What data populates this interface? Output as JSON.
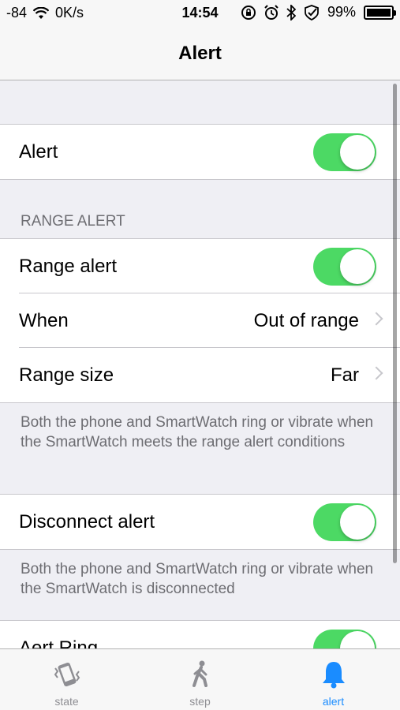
{
  "status_bar": {
    "signal": "-84",
    "network_speed": "0K/s",
    "time": "14:54",
    "battery": "99%"
  },
  "nav": {
    "title": "Alert"
  },
  "settings": {
    "alert_label": "Alert",
    "alert_on": true,
    "range_header": "RANGE ALERT",
    "range_alert_label": "Range alert",
    "range_alert_on": true,
    "when_label": "When",
    "when_value": "Out of range",
    "range_size_label": "Range size",
    "range_size_value": "Far",
    "range_footer": "Both the phone and SmartWatch ring or vibrate when the SmartWatch meets the range alert conditions",
    "disconnect_label": "Disconnect alert",
    "disconnect_on": true,
    "disconnect_footer": "Both the phone and SmartWatch ring or vibrate when the SmartWatch is disconnected",
    "ring_label": "Aert Ring",
    "ring_on": true
  },
  "tabs": [
    {
      "label": "state",
      "icon": "phone-vibrate-icon",
      "active": false
    },
    {
      "label": "step",
      "icon": "walking-person-icon",
      "active": false
    },
    {
      "label": "alert",
      "icon": "bell-icon",
      "active": true
    }
  ],
  "colors": {
    "switch_on": "#4cd964",
    "tab_active": "#1a8cff",
    "tab_inactive": "#8e8e93"
  }
}
